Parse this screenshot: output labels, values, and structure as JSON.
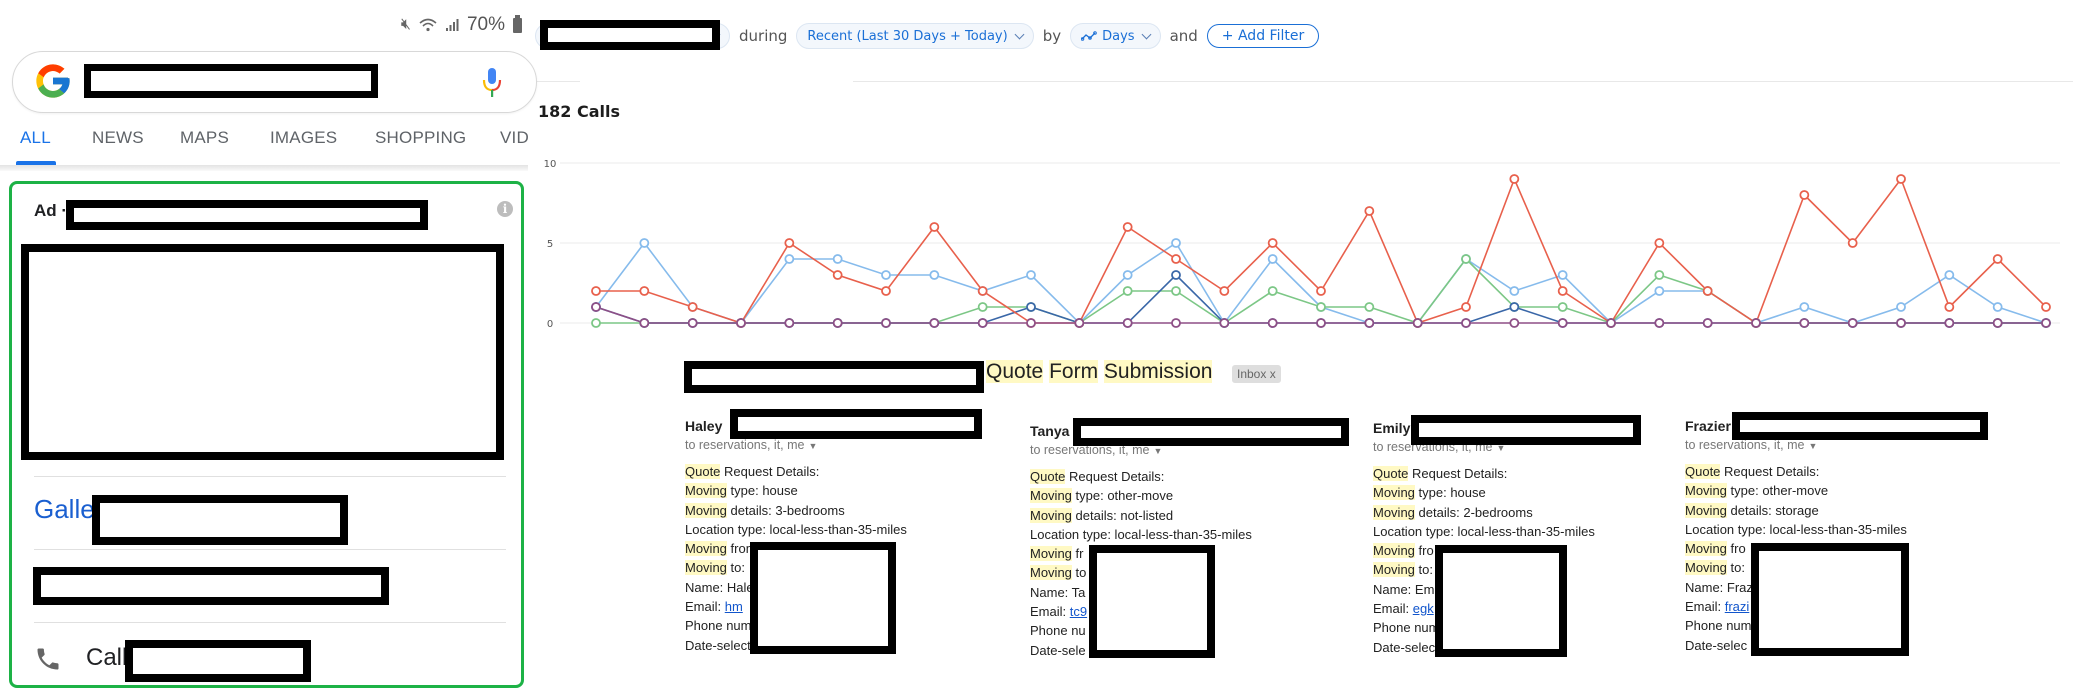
{
  "phone": {
    "status_bar": {
      "icons": [
        "mute-icon",
        "wifi-icon",
        "signal-icon"
      ],
      "battery": "70%"
    },
    "search": {
      "query": ""
    },
    "tabs": [
      {
        "label": "ALL",
        "active": true
      },
      {
        "label": "NEWS",
        "active": false
      },
      {
        "label": "MAPS",
        "active": false
      },
      {
        "label": "IMAGES",
        "active": false
      },
      {
        "label": "SHOPPING",
        "active": false
      },
      {
        "label": "VID",
        "active": false
      }
    ],
    "ad": {
      "label": "Ad ·",
      "sitelink_prefix": "Galler",
      "call_label": "Call"
    }
  },
  "filters": {
    "during_label": "during",
    "range": "Recent (Last 30 Days + Today)",
    "by_label": "by",
    "interval": "Days",
    "and_label": "and",
    "add_filter": "+ Add Filter"
  },
  "summary": {
    "calls_title": "182 Calls"
  },
  "chart_data": {
    "type": "line",
    "title": "182 Calls",
    "xlabel": "",
    "ylabel": "",
    "ylim": [
      0,
      10
    ],
    "yticks": [
      "0",
      "5",
      "10"
    ],
    "grid": true,
    "x": [
      1,
      2,
      3,
      4,
      5,
      6,
      7,
      8,
      9,
      10,
      11,
      12,
      13,
      14,
      15,
      16,
      17,
      18,
      19,
      20,
      21,
      22,
      23,
      24,
      25,
      26,
      27,
      28,
      29,
      30,
      31
    ],
    "series": [
      {
        "name": "series-red",
        "color": "#e8604c",
        "values": [
          2,
          2,
          1,
          0,
          5,
          3,
          2,
          6,
          2,
          0,
          0,
          6,
          4,
          2,
          5,
          2,
          7,
          0,
          1,
          9,
          2,
          0,
          5,
          2,
          0,
          8,
          5,
          9,
          1,
          4,
          1
        ]
      },
      {
        "name": "series-light-blue",
        "color": "#86bbec",
        "values": [
          1,
          5,
          1,
          0,
          4,
          4,
          3,
          3,
          2,
          3,
          0,
          3,
          5,
          0,
          4,
          1,
          0,
          0,
          4,
          2,
          3,
          0,
          2,
          2,
          0,
          1,
          0,
          1,
          3,
          1,
          0
        ]
      },
      {
        "name": "series-green",
        "color": "#7cc786",
        "values": [
          0,
          0,
          0,
          0,
          0,
          0,
          0,
          0,
          1,
          1,
          0,
          2,
          2,
          0,
          2,
          1,
          1,
          0,
          4,
          1,
          1,
          0,
          3,
          2,
          0,
          0,
          0,
          0,
          0,
          0,
          0
        ]
      },
      {
        "name": "series-dark-blue",
        "color": "#3a67a8",
        "values": [
          1,
          0,
          0,
          0,
          0,
          0,
          0,
          0,
          0,
          1,
          0,
          0,
          3,
          0,
          0,
          0,
          0,
          0,
          0,
          1,
          0,
          0,
          0,
          0,
          0,
          0,
          0,
          0,
          0,
          0,
          0
        ]
      },
      {
        "name": "series-purple",
        "color": "#8e4f86",
        "values": [
          1,
          0,
          0,
          0,
          0,
          0,
          0,
          0,
          0,
          0,
          0,
          0,
          0,
          0,
          0,
          0,
          0,
          0,
          0,
          0,
          0,
          0,
          0,
          0,
          0,
          0,
          0,
          0,
          0,
          0,
          0
        ]
      }
    ]
  },
  "email": {
    "subject_words": [
      "Quote",
      "Form",
      "Submission"
    ],
    "label_badge": "Inbox x",
    "messages": [
      {
        "sender": "Haley",
        "recipients": "to reservations, it, me",
        "lines": [
          [
            "Quote",
            " Request Details:"
          ],
          [
            "Moving",
            " type: house"
          ],
          [
            "Moving",
            " details: 3-bedrooms"
          ],
          [
            "",
            "Location type: local-less-than-35-miles"
          ],
          [
            "Moving",
            " from"
          ],
          [
            "Moving",
            " to:"
          ],
          [
            "",
            "Name: Hale"
          ],
          [
            "",
            "Email: ",
            "hm"
          ],
          [
            "",
            "Phone num"
          ],
          [
            "",
            "Date-select"
          ]
        ]
      },
      {
        "sender": "Tanya",
        "recipients": "to reservations, it, me",
        "lines": [
          [
            "Quote",
            " Request Details:"
          ],
          [
            "Moving",
            " type: other-move"
          ],
          [
            "Moving",
            " details: not-listed"
          ],
          [
            "",
            "Location type: local-less-than-35-miles"
          ],
          [
            "Moving",
            " fr"
          ],
          [
            "Moving",
            " to"
          ],
          [
            "",
            "Name: Ta"
          ],
          [
            "",
            "Email: ",
            "tc9"
          ],
          [
            "",
            "Phone nu"
          ],
          [
            "",
            "Date-sele"
          ]
        ]
      },
      {
        "sender": "Emily",
        "recipients": "to reservations, it, me",
        "lines": [
          [
            "Quote",
            " Request Details:"
          ],
          [
            "Moving",
            " type: house"
          ],
          [
            "Moving",
            " details: 2-bedrooms"
          ],
          [
            "",
            "Location type: local-less-than-35-miles"
          ],
          [
            "Moving",
            " fro"
          ],
          [
            "Moving",
            " to:"
          ],
          [
            "",
            "Name: Em"
          ],
          [
            "",
            "Email: ",
            "egk"
          ],
          [
            "",
            "Phone num"
          ],
          [
            "",
            "Date-selec"
          ]
        ]
      },
      {
        "sender": "Frazier",
        "recipients": "to reservations, it, me",
        "lines": [
          [
            "Quote",
            " Request Details:"
          ],
          [
            "Moving",
            " type: other-move"
          ],
          [
            "Moving",
            " details: storage"
          ],
          [
            "",
            "Location type: local-less-than-35-miles"
          ],
          [
            "Moving",
            " fro"
          ],
          [
            "Moving",
            " to:"
          ],
          [
            "",
            "Name: Fraz"
          ],
          [
            "",
            "Email: ",
            "frazi"
          ],
          [
            "",
            "Phone num"
          ],
          [
            "",
            "Date-selec"
          ]
        ]
      }
    ]
  }
}
